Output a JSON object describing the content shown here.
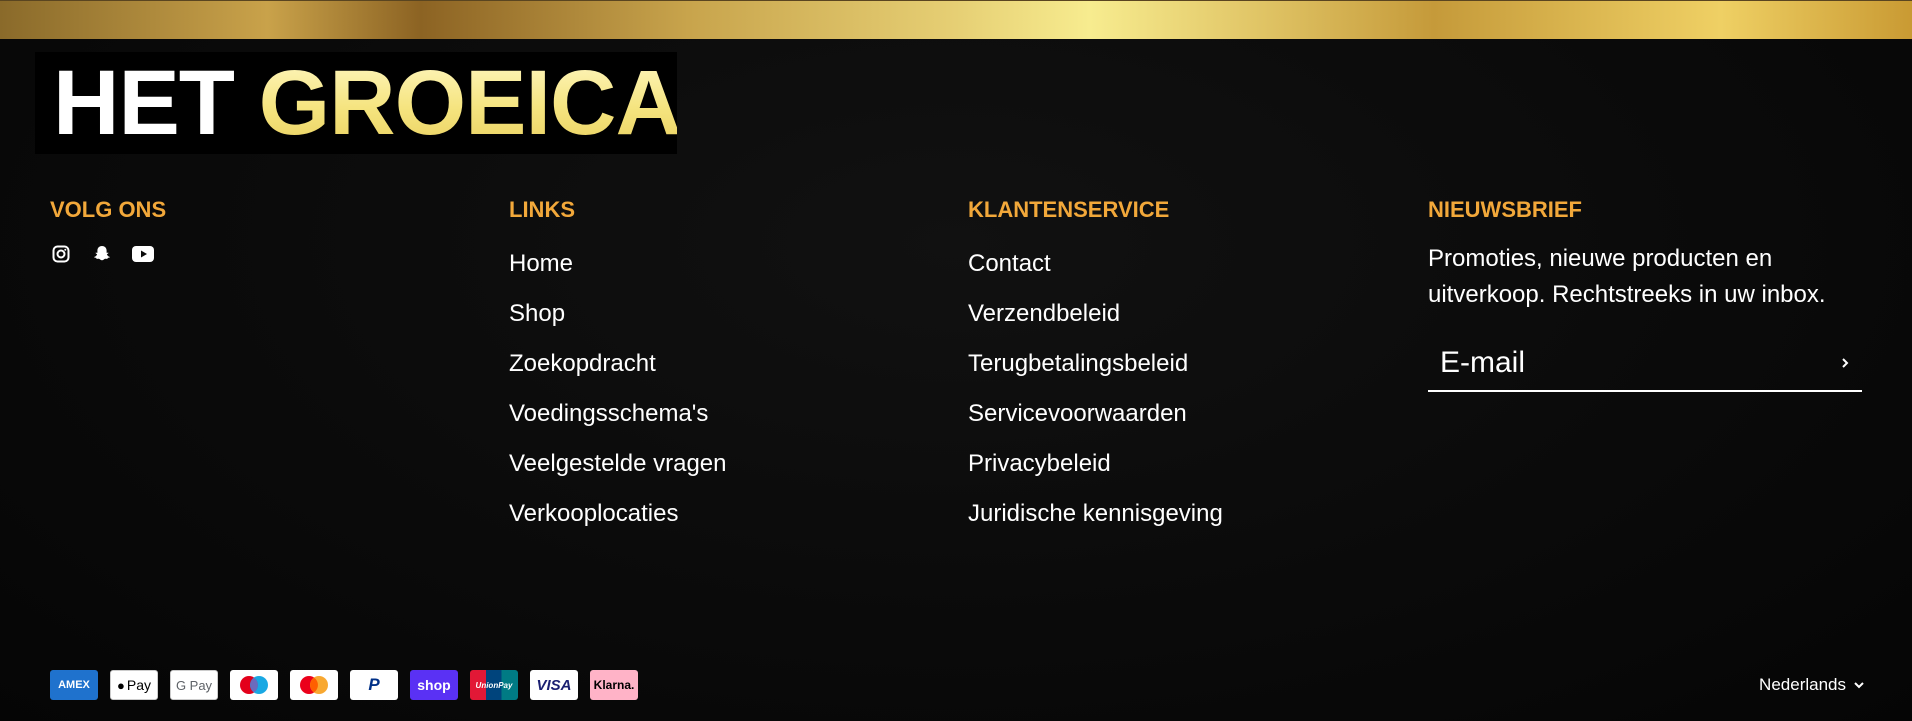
{
  "brand": {
    "logo_word1": "HET",
    "logo_word2": "GROEICAFE"
  },
  "colors": {
    "heading": "#f2a83a",
    "background": "#0a0a0a",
    "gold_light": "#f7ec8f",
    "gold_dark": "#8c6323"
  },
  "columns": {
    "volg": {
      "heading": "VOLG ONS",
      "icons": [
        "instagram-icon",
        "snapchat-icon",
        "youtube-icon"
      ]
    },
    "links": {
      "heading": "LINKS",
      "items": [
        "Home",
        "Shop",
        "Zoekopdracht",
        "Voedingsschema's",
        "Veelgestelde vragen",
        "Verkooplocaties"
      ]
    },
    "klantenservice": {
      "heading": "KLANTENSERVICE",
      "items": [
        "Contact",
        "Verzendbeleid",
        "Terugbetalingsbeleid",
        "Servicevoorwaarden",
        "Privacybeleid",
        "Juridische kennisgeving"
      ]
    },
    "nieuwsbrief": {
      "heading": "NIEUWSBRIEF",
      "text": "Promoties, nieuwe producten en uitverkoop. Rechtstreeks in uw inbox.",
      "email_placeholder": "E-mail"
    }
  },
  "payments": {
    "amex": "AMEX",
    "applepay": "Pay",
    "gpay": "G Pay",
    "maestro": "",
    "mastercard": "",
    "paypal": "P",
    "shop": "shop",
    "unionpay": "UnionPay",
    "visa": "VISA",
    "klarna": "Klarna."
  },
  "language": {
    "label": "Nederlands"
  }
}
